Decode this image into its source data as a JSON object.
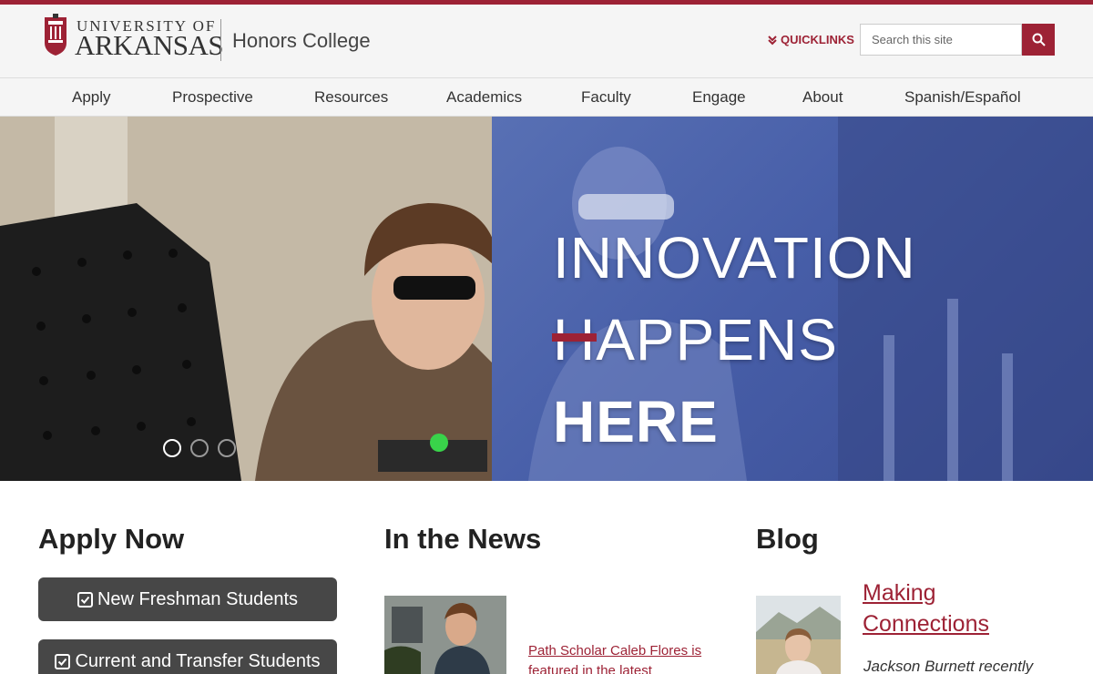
{
  "brand": {
    "university_line1": "UNIVERSITY OF",
    "university_line2": "ARKANSAS",
    "college": "Honors College",
    "accent_color": "#9d2235"
  },
  "header": {
    "quicklinks_label": "QUICKLINKS",
    "quicklinks_icon": "double-chevron-down-icon",
    "search_placeholder": "Search this site",
    "search_icon": "search-icon"
  },
  "nav": {
    "items": [
      "Apply",
      "Prospective",
      "Resources",
      "Academics",
      "Faculty",
      "Engage",
      "About",
      "Spanish/Español"
    ]
  },
  "hero": {
    "line1": "INNOVATION",
    "line2": "HAPPENS",
    "line3": "HERE",
    "slides": 3,
    "active_slide": 1
  },
  "apply": {
    "title": "Apply Now",
    "buttons": [
      "New Freshman Students",
      "Current and Transfer Students"
    ],
    "button_icon": "checkbox-icon"
  },
  "news": {
    "title": "In the News",
    "item_link": "Path Scholar Caleb Flores is featured in the latest"
  },
  "blog": {
    "title": "Blog",
    "post_title": "Making Connections",
    "post_excerpt": "Jackson Burnett recently"
  }
}
